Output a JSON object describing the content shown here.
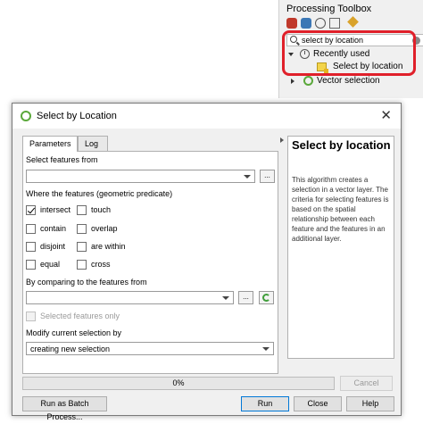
{
  "toolbox": {
    "title": "Processing Toolbox",
    "search_value": "select by location",
    "tree": [
      {
        "label": "Recently used",
        "expanded": true
      },
      {
        "label": "Select by location"
      },
      {
        "label": "Vector selection",
        "expanded": false
      }
    ],
    "highlight_color": "#e0202a"
  },
  "dialog": {
    "title": "Select by Location",
    "close_glyph": "✕",
    "tabs": [
      "Parameters",
      "Log"
    ],
    "select_features_from_label": "Select features from",
    "select_features_from_value": "",
    "predicate_label": "Where the features (geometric predicate)",
    "predicates": [
      {
        "label": "intersect",
        "checked": true
      },
      {
        "label": "touch",
        "checked": false
      },
      {
        "label": "contain",
        "checked": false
      },
      {
        "label": "overlap",
        "checked": false
      },
      {
        "label": "disjoint",
        "checked": false
      },
      {
        "label": "are within",
        "checked": false
      },
      {
        "label": "equal",
        "checked": false
      },
      {
        "label": "cross",
        "checked": false
      }
    ],
    "comparing_label": "By comparing to the features from",
    "comparing_value": "",
    "selected_only_label": "Selected features only",
    "modify_label": "Modify current selection by",
    "modify_value": "creating new selection",
    "browse_label": "...",
    "help_title": "Select by location",
    "help_text": "This algorithm creates a selection in a vector layer. The criteria for selecting features is based on the spatial relationship between each feature and the features in an additional layer.",
    "progress_text": "0%",
    "progress": 0,
    "buttons": {
      "cancel": "Cancel",
      "batch": "Run as Batch Process...",
      "run": "Run",
      "close": "Close",
      "help": "Help"
    }
  }
}
